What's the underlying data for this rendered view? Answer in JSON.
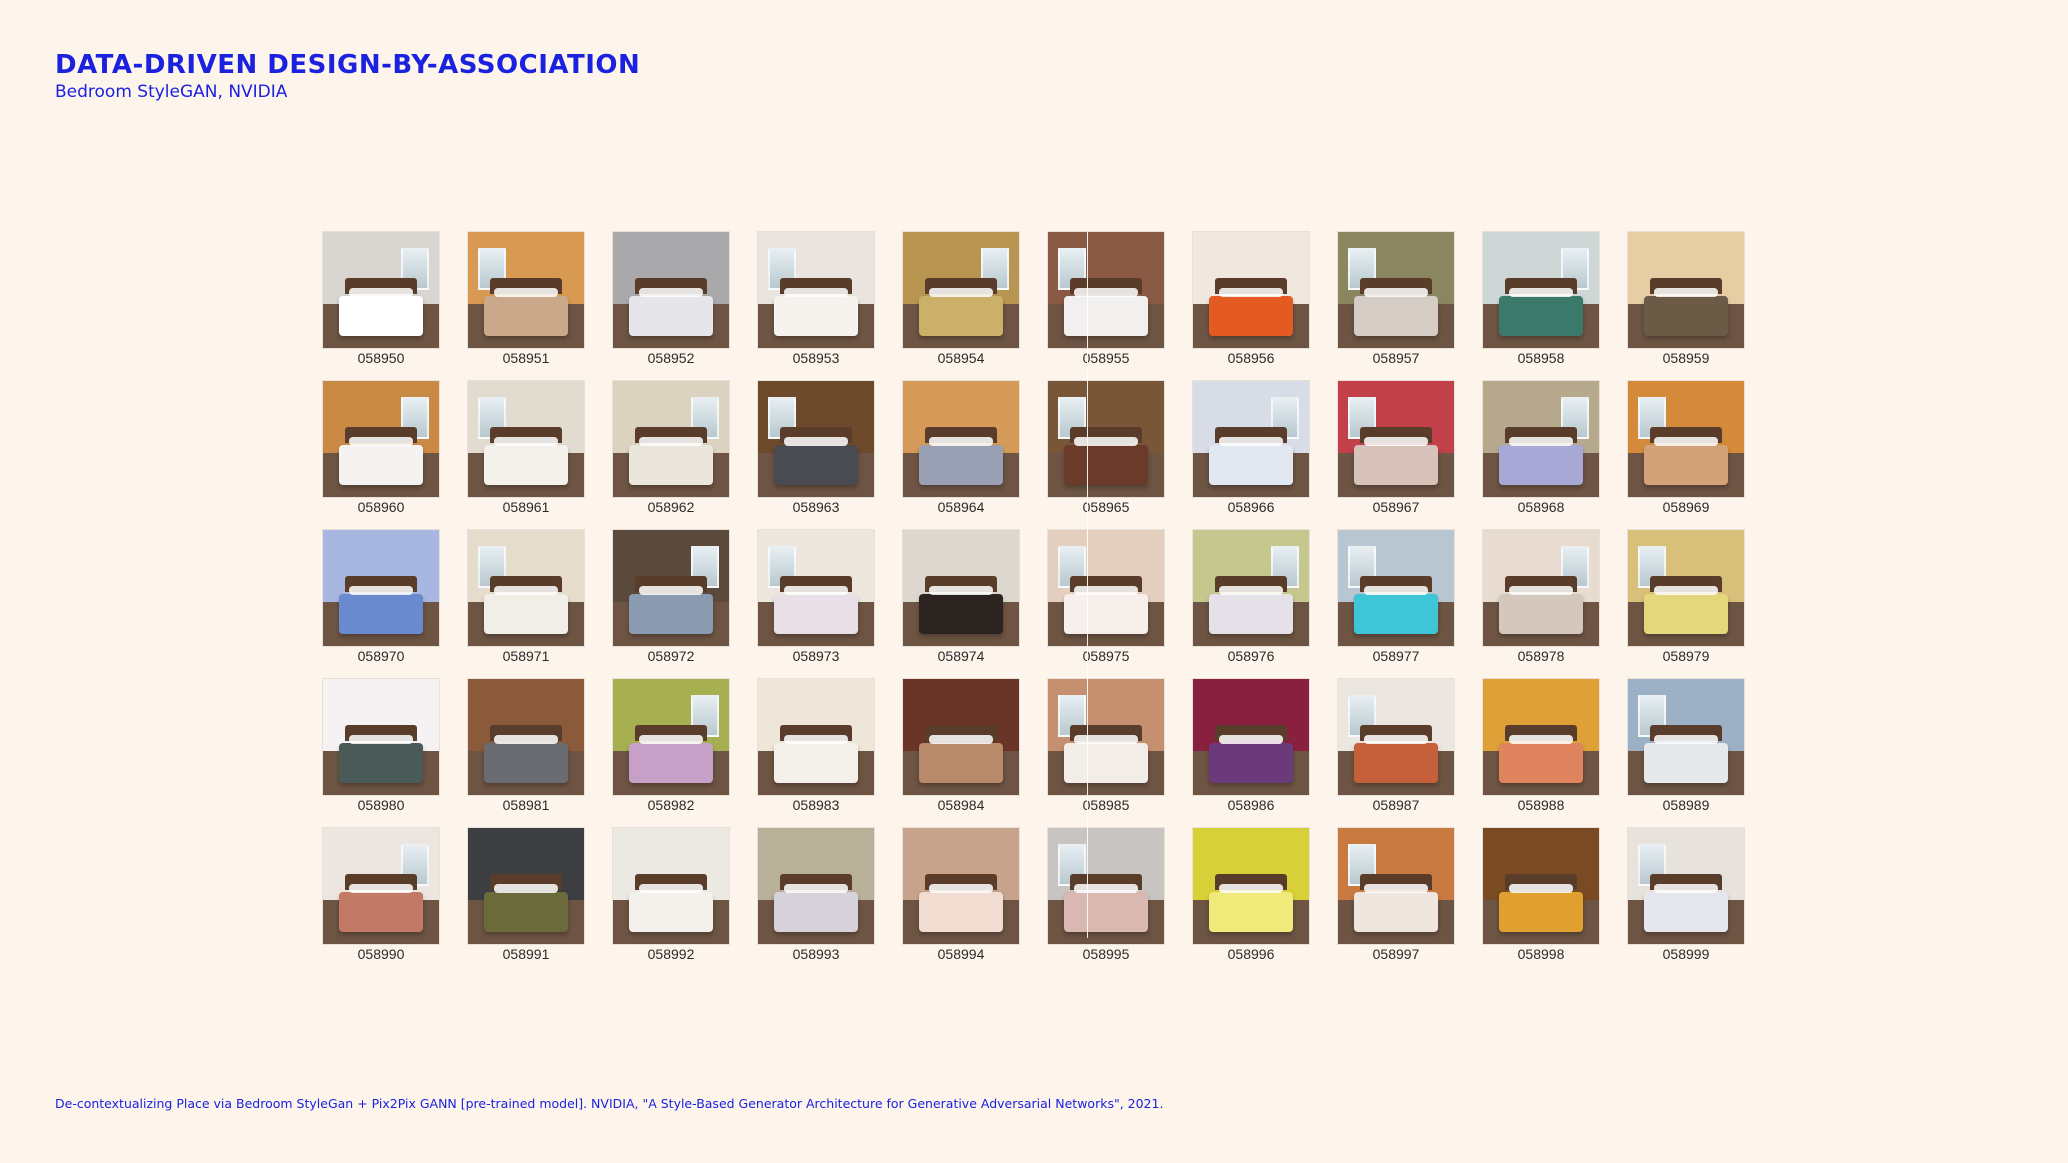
{
  "header": {
    "title": "DATA-DRIVEN DESIGN-BY-ASSOCIATION",
    "subtitle": "Bedroom StyleGAN, NVIDIA"
  },
  "footer": {
    "caption": "De-contextualizing Place via Bedroom StyleGan + Pix2Pix GANN [pre-trained model].  NVIDIA, \"A Style-Based Generator Architecture for Generative Adversarial Networks\", 2021."
  },
  "images": [
    {
      "label": "058950",
      "wall": "#d9d6d2",
      "bed": "#ffffff",
      "win": true
    },
    {
      "label": "058951",
      "wall": "#d89a52",
      "bed": "#c9a98a",
      "win": true
    },
    {
      "label": "058952",
      "wall": "#a9a8aa",
      "bed": "#e6e6ea",
      "win": false
    },
    {
      "label": "058953",
      "wall": "#e9e4de",
      "bed": "#f6f3ef",
      "win": true
    },
    {
      "label": "058954",
      "wall": "#b89550",
      "bed": "#cbb06a",
      "win": true
    },
    {
      "label": "058955",
      "wall": "#8a5a44",
      "bed": "#f2f0ee",
      "win": true
    },
    {
      "label": "058956",
      "wall": "#f0e8de",
      "bed": "#e45a23",
      "win": false
    },
    {
      "label": "058957",
      "wall": "#8a8660",
      "bed": "#d6ccc6",
      "win": true
    },
    {
      "label": "058958",
      "wall": "#cfd6d6",
      "bed": "#3b7a6a",
      "win": true
    },
    {
      "label": "058959",
      "wall": "#e6cda4",
      "bed": "#6a5a46",
      "win": false
    },
    {
      "label": "058960",
      "wall": "#c88a44",
      "bed": "#f5f2f2",
      "win": true
    },
    {
      "label": "058961",
      "wall": "#e2dbd0",
      "bed": "#f4f1ec",
      "win": true
    },
    {
      "label": "058962",
      "wall": "#dcd2c0",
      "bed": "#ebe6dc",
      "win": true
    },
    {
      "label": "058963",
      "wall": "#6e4a2c",
      "bed": "#4a4a52",
      "win": true
    },
    {
      "label": "058964",
      "wall": "#d59a58",
      "bed": "#9aa0b4",
      "win": false
    },
    {
      "label": "058965",
      "wall": "#7a5638",
      "bed": "#6a3a2a",
      "win": true
    },
    {
      "label": "058966",
      "wall": "#d8dce6",
      "bed": "#e2e8f2",
      "win": true
    },
    {
      "label": "058967",
      "wall": "#c2404a",
      "bed": "#d6c2b8",
      "win": true
    },
    {
      "label": "058968",
      "wall": "#b7a98e",
      "bed": "#a8a8d6",
      "win": true
    },
    {
      "label": "058969",
      "wall": "#d48a3a",
      "bed": "#d4a278",
      "win": true
    },
    {
      "label": "058970",
      "wall": "#a8b6e2",
      "bed": "#6a8ad0",
      "win": false
    },
    {
      "label": "058971",
      "wall": "#e6dccc",
      "bed": "#f1eee8",
      "win": true
    },
    {
      "label": "058972",
      "wall": "#5a4a3c",
      "bed": "#8a9ab0",
      "win": true
    },
    {
      "label": "058973",
      "wall": "#ece6de",
      "bed": "#e8e0e6",
      "win": true
    },
    {
      "label": "058974",
      "wall": "#dcd8d0",
      "bed": "#2c2420",
      "win": false
    },
    {
      "label": "058975",
      "wall": "#e4cfbe",
      "bed": "#f6efec",
      "win": true
    },
    {
      "label": "058976",
      "wall": "#c6c78e",
      "bed": "#e4e2e8",
      "win": true
    },
    {
      "label": "058977",
      "wall": "#b8c6d2",
      "bed": "#3ec6d8",
      "win": true
    },
    {
      "label": "058978",
      "wall": "#e8dcd0",
      "bed": "#d4c8bc",
      "win": true
    },
    {
      "label": "058979",
      "wall": "#d8c07a",
      "bed": "#e4d67a",
      "win": true
    },
    {
      "label": "058980",
      "wall": "#f4f2f2",
      "bed": "#4a5a56",
      "win": false
    },
    {
      "label": "058981",
      "wall": "#8a5a3a",
      "bed": "#6a6c72",
      "win": false
    },
    {
      "label": "058982",
      "wall": "#a6b050",
      "bed": "#c6a0c6",
      "win": true
    },
    {
      "label": "058983",
      "wall": "#efe6da",
      "bed": "#f4f0ea",
      "win": false
    },
    {
      "label": "058984",
      "wall": "#6a3426",
      "bed": "#b88a6a",
      "win": false
    },
    {
      "label": "058985",
      "wall": "#c49070",
      "bed": "#f2ede6",
      "win": true
    },
    {
      "label": "058986",
      "wall": "#8a2040",
      "bed": "#6a3a7a",
      "win": false
    },
    {
      "label": "058987",
      "wall": "#ece6e0",
      "bed": "#c6603a",
      "win": true
    },
    {
      "label": "058988",
      "wall": "#e0a038",
      "bed": "#e08460",
      "win": false
    },
    {
      "label": "058989",
      "wall": "#9cb0c6",
      "bed": "#e6e8ec",
      "win": true
    },
    {
      "label": "058990",
      "wall": "#ede6e0",
      "bed": "#c27a66",
      "win": true
    },
    {
      "label": "058991",
      "wall": "#3c3e42",
      "bed": "#6a6a3a",
      "win": false
    },
    {
      "label": "058992",
      "wall": "#ece8e2",
      "bed": "#f4f0ec",
      "win": false
    },
    {
      "label": "058993",
      "wall": "#b8b098",
      "bed": "#d6d2da",
      "win": false
    },
    {
      "label": "058994",
      "wall": "#c6a38a",
      "bed": "#f0dcd0",
      "win": false
    },
    {
      "label": "058995",
      "wall": "#c8c4c2",
      "bed": "#d8b8b0",
      "win": true
    },
    {
      "label": "058996",
      "wall": "#d8d038",
      "bed": "#f0ea7a",
      "win": false
    },
    {
      "label": "058997",
      "wall": "#c87a40",
      "bed": "#f0e6e0",
      "win": true
    },
    {
      "label": "058998",
      "wall": "#7a4a22",
      "bed": "#e0a030",
      "win": false
    },
    {
      "label": "058999",
      "wall": "#e8e2dc",
      "bed": "#e6e6ee",
      "win": true
    }
  ]
}
